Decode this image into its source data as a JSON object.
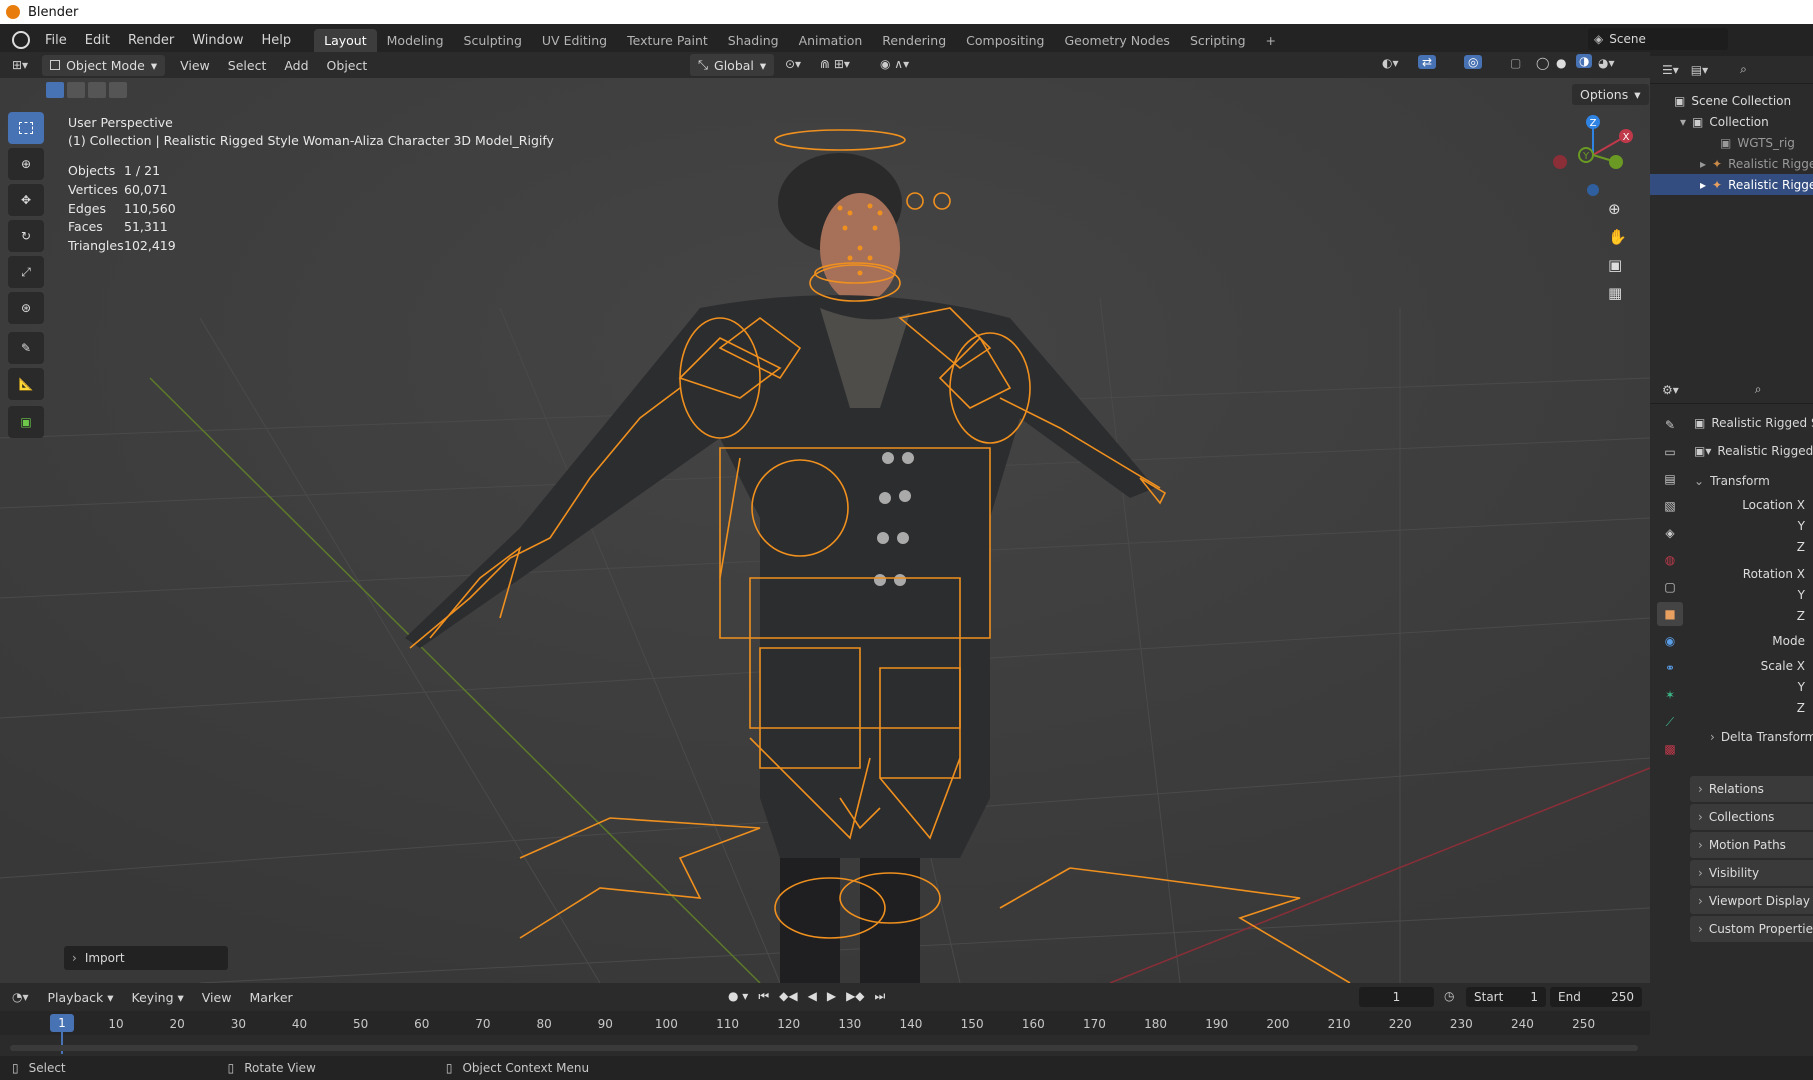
{
  "window_title": "Blender",
  "menu": [
    "File",
    "Edit",
    "Render",
    "Window",
    "Help"
  ],
  "workspaces": [
    "Layout",
    "Modeling",
    "Sculpting",
    "UV Editing",
    "Texture Paint",
    "Shading",
    "Animation",
    "Rendering",
    "Compositing",
    "Geometry Nodes",
    "Scripting"
  ],
  "active_workspace": "Layout",
  "scene_name": "Scene",
  "viewport_header": {
    "mode": "Object Mode",
    "menus": [
      "View",
      "Select",
      "Add",
      "Object"
    ],
    "transform_orientation": "Global",
    "options_label": "Options"
  },
  "viewport": {
    "perspective": "User Perspective",
    "collection_line": "(1) Collection | Realistic Rigged Style Woman-Aliza Character 3D Model_Rigify",
    "stats": [
      {
        "label": "Objects",
        "value": "1 / 21"
      },
      {
        "label": "Vertices",
        "value": "60,071"
      },
      {
        "label": "Edges",
        "value": "110,560"
      },
      {
        "label": "Faces",
        "value": "51,311"
      },
      {
        "label": "Triangles",
        "value": "102,419"
      }
    ],
    "import_panel": "Import",
    "gizmo_axes": {
      "x": "X",
      "y": "Y",
      "z": "Z"
    }
  },
  "outliner": {
    "rows": [
      {
        "label": "Scene Collection",
        "selected": false
      },
      {
        "label": "Collection",
        "selected": false
      },
      {
        "label": "WGTS_rig",
        "selected": false
      },
      {
        "label": "Realistic Rigge",
        "selected": false
      },
      {
        "label": "Realistic Rigge",
        "selected": true
      }
    ]
  },
  "properties": {
    "object_name_1": "Realistic Rigged St",
    "object_name_2": "Realistic Rigged",
    "transform_header": "Transform",
    "fields": [
      "Location X",
      "Y",
      "Z",
      "Rotation X",
      "Y",
      "Z",
      "Mode",
      "Scale X",
      "Y",
      "Z"
    ],
    "delta_transform": "Delta Transform",
    "panels": [
      "Relations",
      "Collections",
      "Motion Paths",
      "Visibility",
      "Viewport Display",
      "Custom Properties"
    ]
  },
  "timeline": {
    "menus": [
      "Playback",
      "Keying",
      "View",
      "Marker"
    ],
    "current_frame": "1",
    "start_label": "Start",
    "start_value": "1",
    "end_label": "End",
    "end_value": "250",
    "ticks": [
      "10",
      "20",
      "30",
      "40",
      "50",
      "60",
      "70",
      "80",
      "90",
      "100",
      "110",
      "120",
      "130",
      "140",
      "150",
      "160",
      "170",
      "180",
      "190",
      "200",
      "210",
      "220",
      "230",
      "240",
      "250"
    ],
    "playhead": "1"
  },
  "statusbar": {
    "select": "Select",
    "rotate": "Rotate View",
    "context": "Object Context Menu"
  },
  "colors": {
    "accent": "#4772b3",
    "rig_orange": "#f0901e",
    "x_axis": "#c0394b",
    "y_axis": "#6a9a23",
    "z_axis": "#2f83e3"
  }
}
